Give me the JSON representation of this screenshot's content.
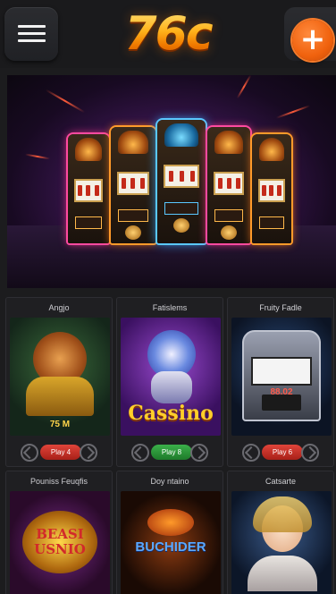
{
  "header": {
    "logo_text": "76c",
    "menu_icon": "hamburger-menu-icon",
    "add_icon": "plus-icon",
    "add_symbol": "+",
    "accent_color": "#f0620e"
  },
  "banner": {
    "subject": "Neon slot machines"
  },
  "games": [
    {
      "title": "Angjo",
      "thumb_text": "75 M",
      "play_label": "Play 4",
      "play_color": "red"
    },
    {
      "title": "Fatislems",
      "thumb_text": "Cassino",
      "play_label": "Play 8",
      "play_color": "green"
    },
    {
      "title": "Fruity Fadle",
      "thumb_text": "88.02",
      "play_label": "Play 6",
      "play_color": "red"
    },
    {
      "title": "Pouniss Feuqfis",
      "thumb_text": "BEASI USNIO",
      "play_label": "",
      "play_color": ""
    },
    {
      "title": "Doy ntaino",
      "thumb_text": "BUCHIDER",
      "play_label": "",
      "play_color": ""
    },
    {
      "title": "Catsarte",
      "thumb_text": "",
      "play_label": "",
      "play_color": ""
    }
  ]
}
